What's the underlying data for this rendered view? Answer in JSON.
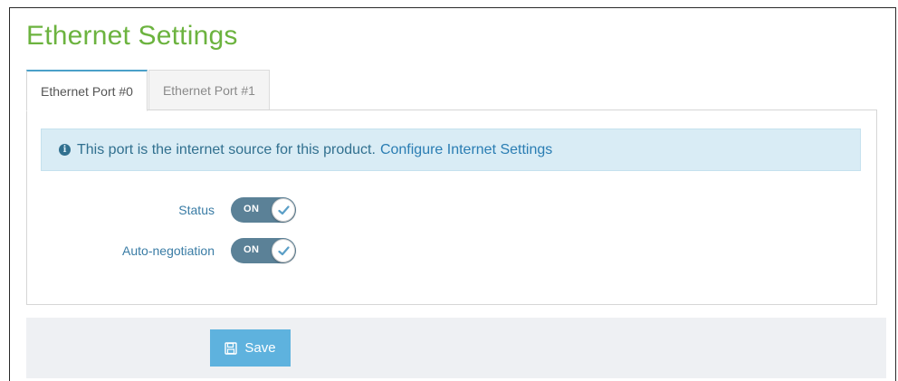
{
  "page": {
    "title": "Ethernet Settings"
  },
  "tabs": [
    {
      "label": "Ethernet Port #0",
      "active": true
    },
    {
      "label": "Ethernet Port #1",
      "active": false
    }
  ],
  "info_banner": {
    "icon": "info-circle-icon",
    "text": "This port is the internet source for this product.",
    "link_text": "Configure Internet Settings"
  },
  "settings": [
    {
      "label": "Status",
      "toggle_text": "ON",
      "state": "on"
    },
    {
      "label": "Auto-negotiation",
      "toggle_text": "ON",
      "state": "on"
    }
  ],
  "footer": {
    "save_label": "Save",
    "save_icon": "floppy-disk-icon"
  },
  "colors": {
    "title_green": "#6cb33f",
    "info_bg": "#d9ecf5",
    "toggle_on": "#5b8197",
    "save_button": "#5eb2de",
    "tab_active_accent": "#4aa0c9"
  }
}
